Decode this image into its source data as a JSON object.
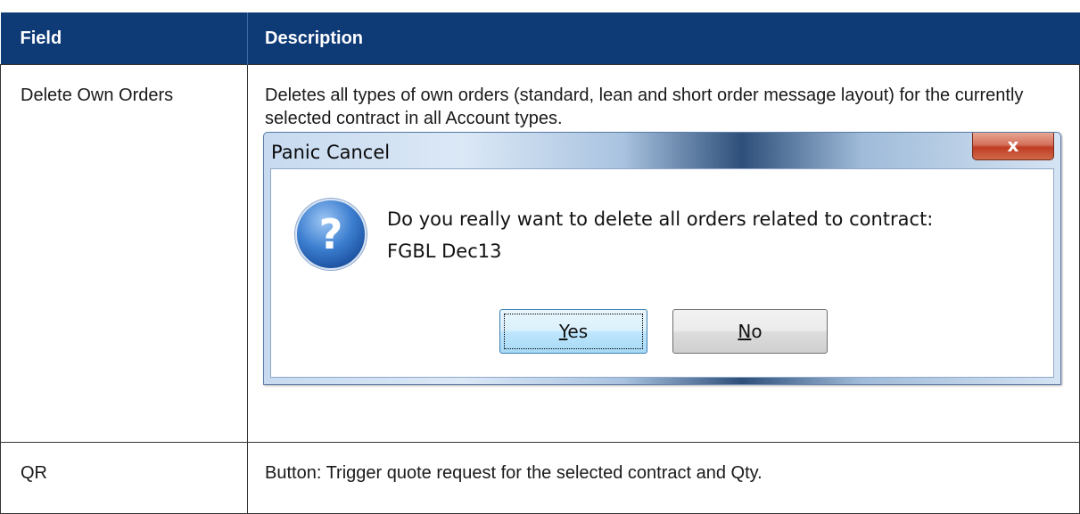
{
  "table": {
    "headers": [
      "Field",
      "Description"
    ],
    "rows": [
      {
        "field": "Delete Own Orders",
        "description": "Deletes all types of own orders (standard, lean and short order message layout) for the currently selected contract in all Account types."
      },
      {
        "field": "QR",
        "description": "Button: Trigger quote request for the selected contract and Qty."
      }
    ]
  },
  "dialog": {
    "title": "Panic Cancel",
    "close_glyph": "x",
    "icon": "question-icon",
    "message_line1": "Do you really want to delete all orders related to contract:",
    "message_line2": "FGBL Dec13",
    "yes_accel": "Y",
    "yes_rest": "es",
    "no_accel": "N",
    "no_rest": "o"
  },
  "colors": {
    "header_bg": "#0e3a75",
    "header_text": "#ffffff"
  }
}
